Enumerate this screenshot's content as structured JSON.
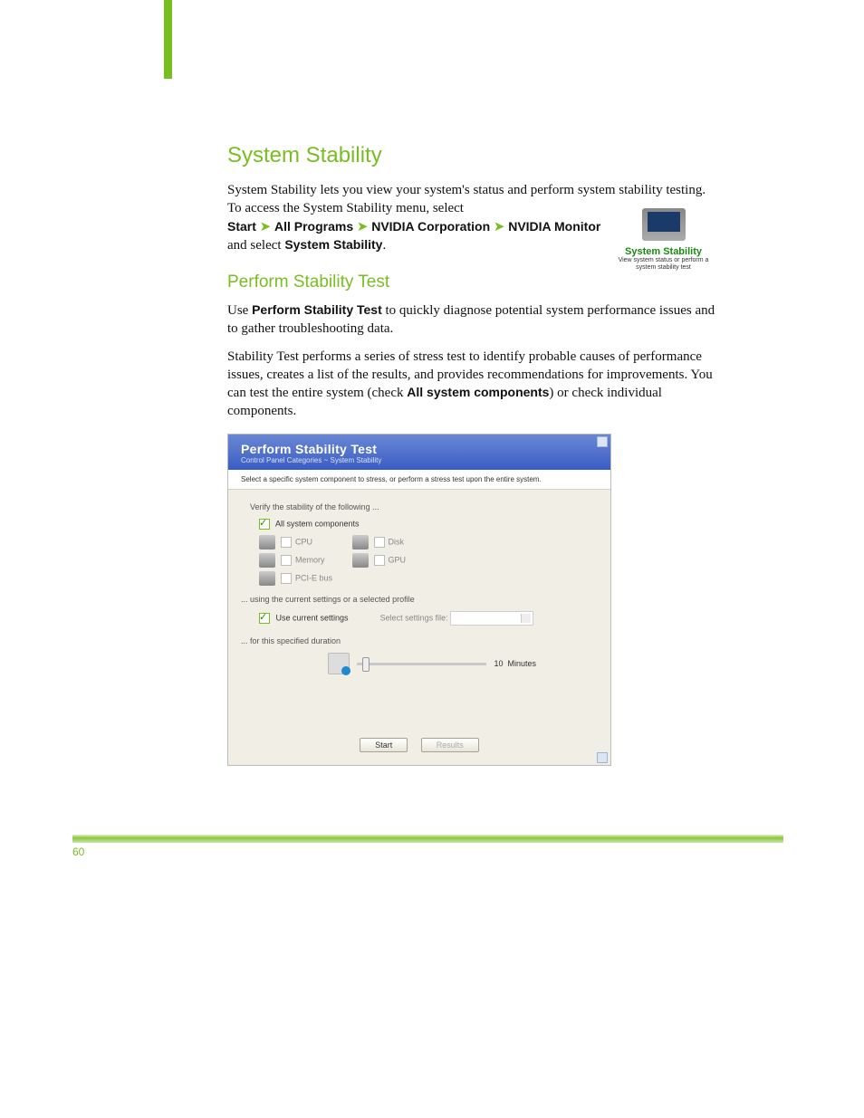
{
  "headings": {
    "h1": "System Stability",
    "h2": "Perform Stability Test"
  },
  "intro": {
    "p1a": "System Stability lets you view your system's status and perform system stability testing. To access the System Stability menu, select",
    "and_select": " and select ",
    "period": "."
  },
  "nav": {
    "start": "Start",
    "arrow": "➤",
    "programs": "All Programs",
    "nvidia": "NVIDIA Corporation",
    "monitor": "NVIDIA Monitor",
    "target": "System Stability"
  },
  "body": {
    "p2a": "Use ",
    "p2b": "Perform Stability Test",
    "p2c": " to quickly diagnose potential system performance issues and to gather troubleshooting data.",
    "p3a": "Stability Test performs a series of stress test to identify probable causes of performance issues, creates a list of the results, and provides recommendations for improvements. You can test the entire system (check ",
    "p3b": "All system components",
    "p3c": ") or check individual components."
  },
  "thumb": {
    "title": "System Stability",
    "caption": "View system status or perform a system stability test"
  },
  "shot": {
    "title": "Perform Stability Test",
    "breadcrumb": "Control Panel Categories  ~  System Stability",
    "description": "Select a specific system component to stress, or perform a stress test upon the entire system.",
    "section1": "Verify the stability of the following ...",
    "all_components": "All system components",
    "comp": {
      "cpu": "CPU",
      "disk": "Disk",
      "memory": "Memory",
      "gpu": "GPU",
      "pcie": "PCI-E bus"
    },
    "section2": "... using the current settings or a selected profile",
    "use_current": "Use current settings",
    "select_file": "Select settings file: ",
    "section3": "... for this specified duration",
    "duration_value": "10",
    "duration_unit": "Minutes",
    "btn_start": "Start",
    "btn_results": "Results"
  },
  "footer": {
    "page": "60",
    "doc": ""
  }
}
